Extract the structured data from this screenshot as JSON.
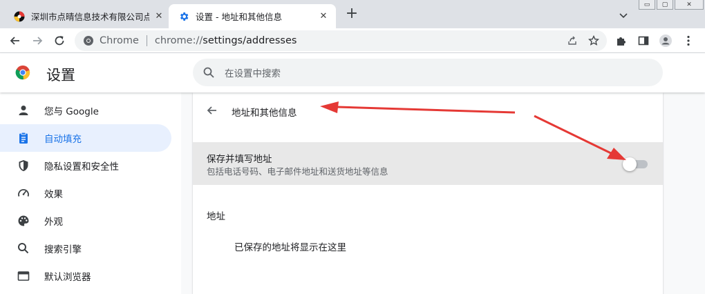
{
  "tabs": [
    {
      "title": "深圳市点晴信息技术有限公司点晴",
      "active": false
    },
    {
      "title": "设置 - 地址和其他信息",
      "active": true
    }
  ],
  "window": {
    "new_tab": "+",
    "minimize": "▭",
    "maximize": "▢",
    "close": "✕"
  },
  "omnibox": {
    "chip": "Chrome",
    "url_prefix": "chrome://",
    "url_path": "settings/addresses"
  },
  "header": {
    "title": "设置",
    "search_placeholder": "在设置中搜索"
  },
  "sidebar": {
    "items": [
      {
        "label": "您与 Google",
        "icon": "person-icon",
        "active": false
      },
      {
        "label": "自动填充",
        "icon": "clipboard-icon",
        "active": true
      },
      {
        "label": "隐私设置和安全性",
        "icon": "shield-icon",
        "active": false
      },
      {
        "label": "效果",
        "icon": "speedometer-icon",
        "active": false
      },
      {
        "label": "外观",
        "icon": "palette-icon",
        "active": false
      },
      {
        "label": "搜索引擎",
        "icon": "search-icon",
        "active": false
      },
      {
        "label": "默认浏览器",
        "icon": "browser-icon",
        "active": false
      }
    ]
  },
  "main": {
    "subpage_title": "地址和其他信息",
    "toggle_row": {
      "label": "保存并填写地址",
      "sublabel": "包括电话号码、电子邮件地址和送货地址等信息",
      "enabled": false
    },
    "section_title": "地址",
    "empty_message": "已保存的地址将显示在这里"
  },
  "colors": {
    "accent": "#1a73e8",
    "annotation_arrow": "#e53935",
    "highlight_row": "#e8e8e8"
  }
}
